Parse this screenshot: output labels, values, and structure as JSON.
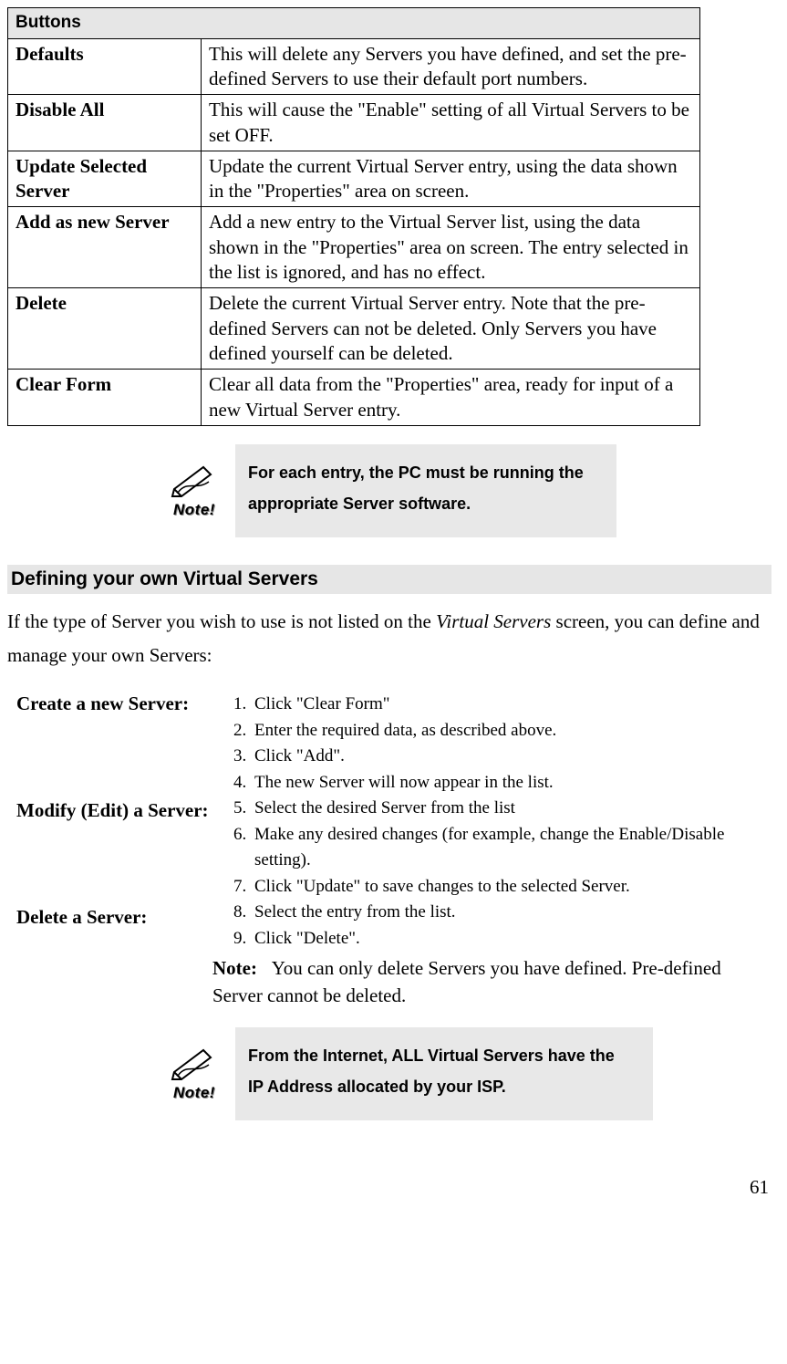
{
  "table": {
    "header": "Buttons",
    "rows": [
      {
        "label": "Defaults",
        "desc": "This will delete any Servers you have defined, and set the pre-defined Servers to use their default port numbers."
      },
      {
        "label": "Disable All",
        "desc": "This will cause the \"Enable\" setting of all Virtual Servers to be set OFF."
      },
      {
        "label": "Update Selected Server",
        "desc": "Update the current Virtual Server entry, using the data shown in the \"Properties\" area on screen."
      },
      {
        "label": "Add as new Server",
        "desc": "Add a new entry to the Virtual Server list, using the data shown in the \"Properties\" area on screen. The entry selected in the list is ignored, and has no effect."
      },
      {
        "label": "Delete",
        "desc": "Delete the current Virtual Server entry. Note that the pre-defined Servers can not be deleted. Only Servers you have defined yourself can be deleted."
      },
      {
        "label": "Clear Form",
        "desc": "Clear all data from the \"Properties\" area, ready for input of a new Virtual Server entry."
      }
    ]
  },
  "note1": {
    "icon_label": "Note!",
    "text": "For each entry, the PC must be running the appropriate Server software."
  },
  "section_heading": "Defining your own Virtual Servers",
  "intro_1": "If the type of Server you wish to use is not listed on the ",
  "intro_em": "Virtual Servers",
  "intro_2": " screen, you can define and manage your own Servers:",
  "labels": {
    "create": "Create a new Server:",
    "modify": "Modify (Edit) a Server:",
    "delete": "Delete a Server:"
  },
  "steps": [
    "Click \"Clear Form\"",
    "Enter the required data, as described above.",
    "Click \"Add\".",
    "The new Server will now appear in the list.",
    "Select the desired Server from the list",
    "Make any desired changes (for example, change the Enable/Disable setting).",
    "Click \"Update\" to save changes to the selected Server.",
    "Select the entry from the list.",
    "Click \"Delete\"."
  ],
  "steps_note": {
    "bold": "Note:",
    "text": "You can only delete Servers you have defined. Pre-defined Server cannot be deleted."
  },
  "note2": {
    "icon_label": "Note!",
    "text": "From the Internet, ALL Virtual Servers have the IP Address allocated by your ISP."
  },
  "page_number": "61"
}
